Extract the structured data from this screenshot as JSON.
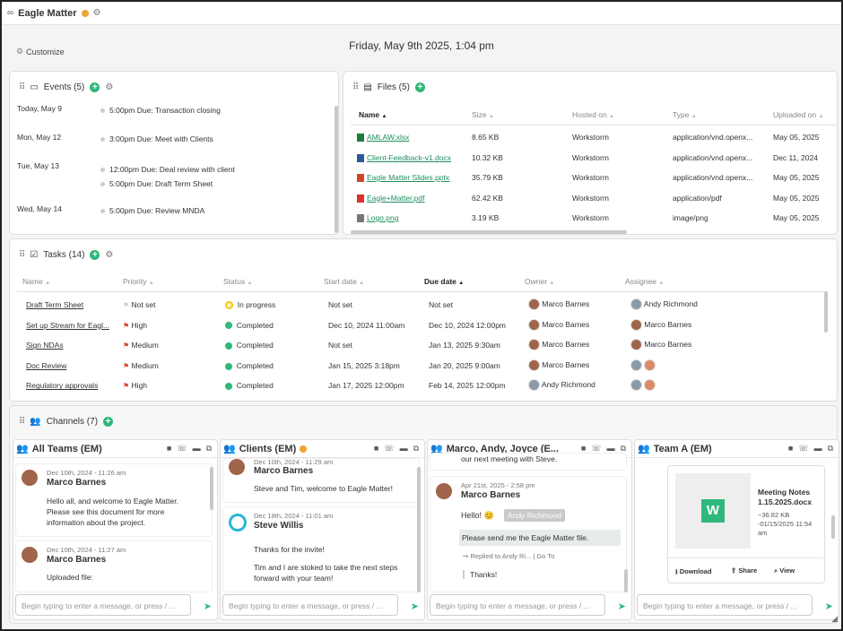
{
  "app": {
    "title": "Eagle Matter",
    "customize": "Customize",
    "datetime": "Friday, May 9th 2025, 1:04 pm"
  },
  "events": {
    "title": "Events (5)",
    "rows": [
      {
        "day": "Today, May 9",
        "items": [
          {
            "time": "5:00pm",
            "label": "Due: Transaction closing"
          }
        ]
      },
      {
        "day": "Mon, May 12",
        "items": [
          {
            "time": "3:00pm",
            "label": "Due: Meet with Clients"
          }
        ]
      },
      {
        "day": "Tue, May 13",
        "items": [
          {
            "time": "12:00pm",
            "label": "Due: Deal review with client"
          },
          {
            "time": "5:00pm",
            "label": "Due: Draft Term Sheet"
          }
        ]
      },
      {
        "day": "Wed, May 14",
        "items": [
          {
            "time": "5:00pm",
            "label": "Due: Review MNDA"
          }
        ]
      }
    ]
  },
  "files": {
    "title": "Files (5)",
    "columns": [
      "Name",
      "Size",
      "Hosted on",
      "Type",
      "Uploaded on"
    ],
    "rows": [
      {
        "name": "AMLAW.xlsx",
        "size": "8.65 KB",
        "host": "Workstorm",
        "type": "application/vnd.openx...",
        "date": "May 05, 2025",
        "color": "#1f7a3f"
      },
      {
        "name": "Client-Feedback-v1.docx",
        "size": "10.32 KB",
        "host": "Workstorm",
        "type": "application/vnd.openx...",
        "date": "Dec 11, 2024",
        "color": "#2b579a"
      },
      {
        "name": "Eagle Matter Slides.pptx",
        "size": "35.79 KB",
        "host": "Workstorm",
        "type": "application/vnd.openx...",
        "date": "May 05, 2025",
        "color": "#d04423"
      },
      {
        "name": "Eagle+Matter.pdf",
        "size": "62.42 KB",
        "host": "Workstorm",
        "type": "application/pdf",
        "date": "May 05, 2025",
        "color": "#d9302c"
      },
      {
        "name": "Logo.png",
        "size": "3.19 KB",
        "host": "Workstorm",
        "type": "image/png",
        "date": "May 05, 2025",
        "color": "#777777"
      }
    ]
  },
  "tasks": {
    "title": "Tasks (14)",
    "columns": [
      "Name",
      "Priority",
      "Status",
      "Start date",
      "Due date",
      "Owner",
      "Assignee"
    ],
    "rows": [
      {
        "name": "Draft Term Sheet",
        "priority": "Not set",
        "status": "In progress",
        "start": "Not set",
        "due": "Not set",
        "owner": "Marco Barnes",
        "assignee": "Andy Richmond"
      },
      {
        "name": "Set up Stream for Eagl...",
        "priority": "High",
        "status": "Completed",
        "start": "Dec 10, 2024 11:00am",
        "due": "Dec 10, 2024 12:00pm",
        "owner": "Marco Barnes",
        "assignee": "Marco Barnes"
      },
      {
        "name": "Sign NDAs",
        "priority": "Medium",
        "status": "Completed",
        "start": "Not set",
        "due": "Jan 13, 2025 9:30am",
        "owner": "Marco Barnes",
        "assignee": "Marco Barnes"
      },
      {
        "name": "Doc Review",
        "priority": "Medium",
        "status": "Completed",
        "start": "Jan 15, 2025 3:18pm",
        "due": "Jan 20, 2025 9:00am",
        "owner": "Marco Barnes",
        "assignee": ""
      },
      {
        "name": "Regulatory approvals",
        "priority": "High",
        "status": "Completed",
        "start": "Jan 17, 2025 12:00pm",
        "due": "Feb 14, 2025 12:00pm",
        "owner": "Andy Richmond",
        "assignee": ""
      }
    ]
  },
  "channels": {
    "title": "Channels (7)",
    "composer_placeholder": "Begin typing to enter a message, or press / ...",
    "list": [
      {
        "name": "All Teams (EM)",
        "messages": [
          {
            "date": "Dec 10th, 2024 - 11:26 am",
            "author": "Marco Barnes",
            "text": "Hello all, and welcome to Eagle Matter. Please see this document for more information about the project."
          },
          {
            "date": "Dec 10th, 2024 - 11:27 am",
            "author": "Marco Barnes",
            "text": "Uploaded file:"
          }
        ]
      },
      {
        "name": "Clients (EM)",
        "messages": [
          {
            "date": "Dec 10th, 2024 - 11:29 am",
            "author": "Marco Barnes",
            "text": "Steve and Tim, welcome to Eagle Matter!"
          },
          {
            "date": "Dec 18th, 2024 - 11:01 am",
            "author": "Steve Willis",
            "text": "Thanks for the invite!",
            "text2": "Tim and I are stoked to take the next steps forward with your team!"
          }
        ]
      },
      {
        "name": "Marco, Andy, Joyce (E...",
        "messages": [
          {
            "date": "",
            "author": "",
            "text": "our next meeting with Steve."
          },
          {
            "date": "Apr 21st, 2025 - 2:58 pm",
            "author": "Marco Barnes",
            "text": "Hello! 😊",
            "mention": "Andy Richmond",
            "highlight": "Please send me the Eagle Matter file.",
            "reply": "Replied to Andy Ri...",
            "goto": "Go To",
            "thanks": "Thanks!"
          }
        ]
      },
      {
        "name": "Team A (EM)",
        "file": {
          "title": "Meeting Notes 1.15.2025.docx",
          "meta": "~36.82 KB -01/15/2025 11:54 am",
          "letter": "W",
          "download": "Download",
          "share": "Share",
          "view": "View"
        }
      }
    ]
  }
}
